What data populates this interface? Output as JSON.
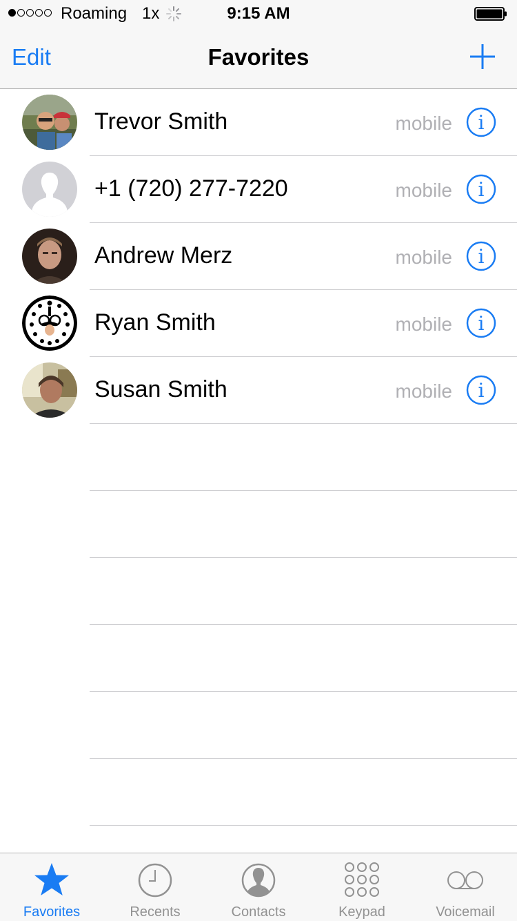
{
  "status_bar": {
    "carrier": "Roaming",
    "network": "1x",
    "time": "9:15 AM"
  },
  "nav": {
    "edit_label": "Edit",
    "title": "Favorites"
  },
  "favorites": [
    {
      "name": "Trevor Smith",
      "type": "mobile"
    },
    {
      "name": "+1 (720) 277-7220",
      "type": "mobile"
    },
    {
      "name": "Andrew Merz",
      "type": "mobile"
    },
    {
      "name": "Ryan Smith",
      "type": "mobile"
    },
    {
      "name": "Susan Smith",
      "type": "mobile"
    }
  ],
  "tabs": [
    {
      "label": "Favorites",
      "icon": "star-icon",
      "active": true
    },
    {
      "label": "Recents",
      "icon": "clock-icon",
      "active": false
    },
    {
      "label": "Contacts",
      "icon": "contact-silhouette-icon",
      "active": false
    },
    {
      "label": "Keypad",
      "icon": "keypad-icon",
      "active": false
    },
    {
      "label": "Voicemail",
      "icon": "voicemail-icon",
      "active": false
    }
  ],
  "colors": {
    "accent": "#1a7cf3",
    "secondary_text": "#b0b0b4",
    "bar_background": "#f7f7f7",
    "separator": "#cfcfd2"
  }
}
